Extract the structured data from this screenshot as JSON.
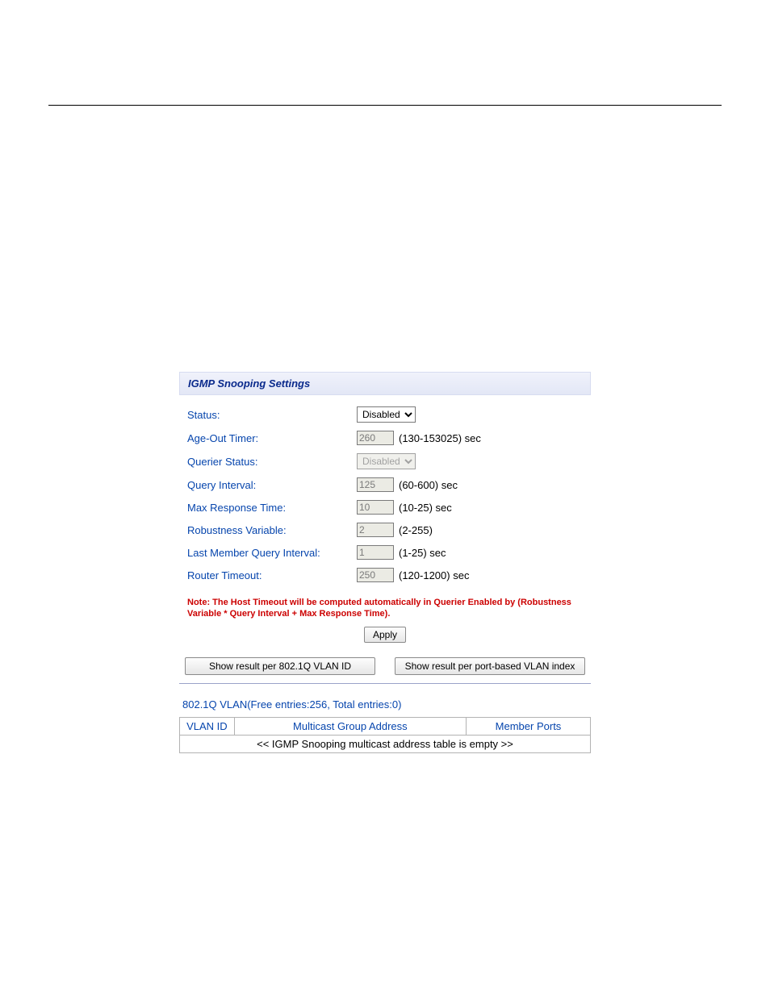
{
  "panel": {
    "title": "IGMP Snooping Settings",
    "fields": {
      "status": {
        "label": "Status:",
        "value": "Disabled"
      },
      "ageOut": {
        "label": "Age-Out Timer:",
        "value": "260",
        "suffix": "(130-153025) sec"
      },
      "querierStatus": {
        "label": "Querier Status:",
        "value": "Disabled"
      },
      "queryInterval": {
        "label": "Query Interval:",
        "value": "125",
        "suffix": "(60-600) sec"
      },
      "maxResponse": {
        "label": "Max Response Time:",
        "value": "10",
        "suffix": "(10-25) sec"
      },
      "robustness": {
        "label": "Robustness Variable:",
        "value": "2",
        "suffix": "(2-255)"
      },
      "lastMemberQI": {
        "label": "Last Member Query Interval:",
        "value": "1",
        "suffix": "(1-25) sec"
      },
      "routerTimeout": {
        "label": "Router Timeout:",
        "value": "250",
        "suffix": "(120-1200) sec"
      }
    },
    "note": "Note: The Host Timeout will be computed automatically in Querier Enabled by (Robustness Variable * Query Interval + Max Response Time).",
    "applyLabel": "Apply",
    "showBy8021q": "Show result per 802.1Q VLAN ID",
    "showByPortBased": "Show result per port-based VLAN index"
  },
  "resultSection": {
    "subtitle": "802.1Q VLAN(Free entries:256, Total entries:0)",
    "columns": {
      "vlanId": "VLAN ID",
      "mga": "Multicast Group Address",
      "memberPorts": "Member Ports"
    },
    "emptyMessage": "<< IGMP Snooping multicast address table is empty >>"
  }
}
